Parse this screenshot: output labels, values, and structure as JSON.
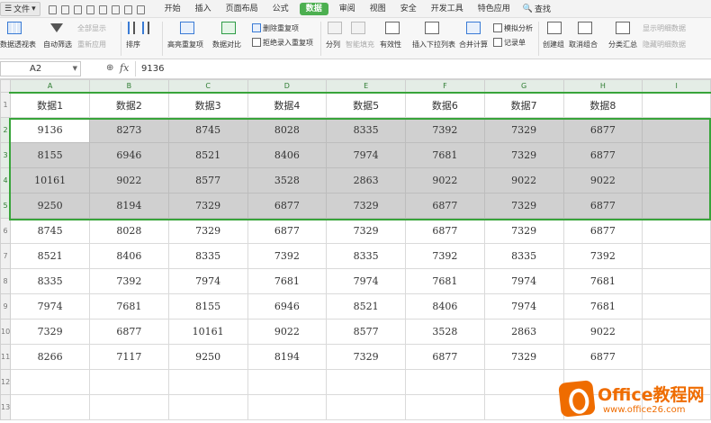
{
  "menu": {
    "file_label": "文件",
    "tabs": [
      "开始",
      "插入",
      "页面布局",
      "公式",
      "数据",
      "审阅",
      "视图",
      "安全",
      "开发工具",
      "特色应用"
    ],
    "active_tab_index": 4,
    "search_label": "查找"
  },
  "ribbon": {
    "pivot": "数据透视表",
    "auto_filter": "自动筛选",
    "show_all": "全部显示",
    "reapply": "重新应用",
    "sort": "排序",
    "highlight_dup": "高亮重复项",
    "data_compare": "数据对比",
    "remove_dup": "删除重复项",
    "reject_dup": "拒绝录入重复项",
    "split": "分列",
    "smart_fill": "智能填充",
    "validity": "有效性",
    "insert_dropdown": "插入下拉列表",
    "merge_calc": "合并计算",
    "simulate": "模拟分析",
    "record": "记录单",
    "create_group": "创建组",
    "ungroup": "取消组合",
    "subtotal": "分类汇总",
    "show_detail": "显示明细数据",
    "hide_detail": "隐藏明细数据"
  },
  "formula_bar": {
    "cell_ref": "A2",
    "fx": "fx",
    "value": "9136"
  },
  "sheet": {
    "columns": [
      "A",
      "B",
      "C",
      "D",
      "E",
      "F",
      "G",
      "H",
      "I"
    ],
    "row_numbers": [
      "1",
      "2",
      "3",
      "4",
      "5",
      "6",
      "7",
      "8",
      "9",
      "10",
      "11",
      "12",
      "13"
    ],
    "header_row": [
      "数据1",
      "数据2",
      "数据3",
      "数据4",
      "数据5",
      "数据6",
      "数据7",
      "数据8"
    ],
    "rows": [
      [
        "9136",
        "8273",
        "8745",
        "8028",
        "8335",
        "7392",
        "7329",
        "6877"
      ],
      [
        "8155",
        "6946",
        "8521",
        "8406",
        "7974",
        "7681",
        "7329",
        "6877"
      ],
      [
        "10161",
        "9022",
        "8577",
        "3528",
        "2863",
        "9022",
        "9022",
        "9022"
      ],
      [
        "9250",
        "8194",
        "7329",
        "6877",
        "7329",
        "6877",
        "7329",
        "6877"
      ],
      [
        "8745",
        "8028",
        "7329",
        "6877",
        "7329",
        "6877",
        "7329",
        "6877"
      ],
      [
        "8521",
        "8406",
        "8335",
        "7392",
        "8335",
        "7392",
        "8335",
        "7392"
      ],
      [
        "8335",
        "7392",
        "7974",
        "7681",
        "7974",
        "7681",
        "7974",
        "7681"
      ],
      [
        "7974",
        "7681",
        "8155",
        "6946",
        "8521",
        "8406",
        "7974",
        "7681"
      ],
      [
        "7329",
        "6877",
        "10161",
        "9022",
        "8577",
        "3528",
        "2863",
        "9022"
      ],
      [
        "8266",
        "7117",
        "9250",
        "8194",
        "7329",
        "6877",
        "7329",
        "6877"
      ]
    ],
    "selection_color": "#38a43a",
    "selected_fill": "#d0d0d0"
  },
  "watermark": {
    "title": "Office教程网",
    "url": "www.office26.com"
  }
}
